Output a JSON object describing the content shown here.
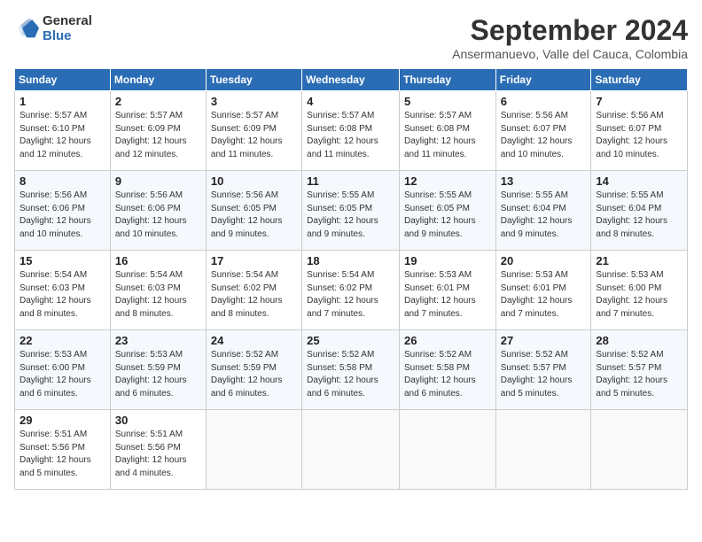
{
  "header": {
    "logo_general": "General",
    "logo_blue": "Blue",
    "month_title": "September 2024",
    "subtitle": "Ansermanuevo, Valle del Cauca, Colombia"
  },
  "days_of_week": [
    "Sunday",
    "Monday",
    "Tuesday",
    "Wednesday",
    "Thursday",
    "Friday",
    "Saturday"
  ],
  "weeks": [
    [
      {
        "day": 1,
        "sunrise": "5:57 AM",
        "sunset": "6:10 PM",
        "daylight": "12 hours and 12 minutes."
      },
      {
        "day": 2,
        "sunrise": "5:57 AM",
        "sunset": "6:09 PM",
        "daylight": "12 hours and 12 minutes."
      },
      {
        "day": 3,
        "sunrise": "5:57 AM",
        "sunset": "6:09 PM",
        "daylight": "12 hours and 11 minutes."
      },
      {
        "day": 4,
        "sunrise": "5:57 AM",
        "sunset": "6:08 PM",
        "daylight": "12 hours and 11 minutes."
      },
      {
        "day": 5,
        "sunrise": "5:57 AM",
        "sunset": "6:08 PM",
        "daylight": "12 hours and 11 minutes."
      },
      {
        "day": 6,
        "sunrise": "5:56 AM",
        "sunset": "6:07 PM",
        "daylight": "12 hours and 10 minutes."
      },
      {
        "day": 7,
        "sunrise": "5:56 AM",
        "sunset": "6:07 PM",
        "daylight": "12 hours and 10 minutes."
      }
    ],
    [
      {
        "day": 8,
        "sunrise": "5:56 AM",
        "sunset": "6:06 PM",
        "daylight": "12 hours and 10 minutes."
      },
      {
        "day": 9,
        "sunrise": "5:56 AM",
        "sunset": "6:06 PM",
        "daylight": "12 hours and 10 minutes."
      },
      {
        "day": 10,
        "sunrise": "5:56 AM",
        "sunset": "6:05 PM",
        "daylight": "12 hours and 9 minutes."
      },
      {
        "day": 11,
        "sunrise": "5:55 AM",
        "sunset": "6:05 PM",
        "daylight": "12 hours and 9 minutes."
      },
      {
        "day": 12,
        "sunrise": "5:55 AM",
        "sunset": "6:05 PM",
        "daylight": "12 hours and 9 minutes."
      },
      {
        "day": 13,
        "sunrise": "5:55 AM",
        "sunset": "6:04 PM",
        "daylight": "12 hours and 9 minutes."
      },
      {
        "day": 14,
        "sunrise": "5:55 AM",
        "sunset": "6:04 PM",
        "daylight": "12 hours and 8 minutes."
      }
    ],
    [
      {
        "day": 15,
        "sunrise": "5:54 AM",
        "sunset": "6:03 PM",
        "daylight": "12 hours and 8 minutes."
      },
      {
        "day": 16,
        "sunrise": "5:54 AM",
        "sunset": "6:03 PM",
        "daylight": "12 hours and 8 minutes."
      },
      {
        "day": 17,
        "sunrise": "5:54 AM",
        "sunset": "6:02 PM",
        "daylight": "12 hours and 8 minutes."
      },
      {
        "day": 18,
        "sunrise": "5:54 AM",
        "sunset": "6:02 PM",
        "daylight": "12 hours and 7 minutes."
      },
      {
        "day": 19,
        "sunrise": "5:53 AM",
        "sunset": "6:01 PM",
        "daylight": "12 hours and 7 minutes."
      },
      {
        "day": 20,
        "sunrise": "5:53 AM",
        "sunset": "6:01 PM",
        "daylight": "12 hours and 7 minutes."
      },
      {
        "day": 21,
        "sunrise": "5:53 AM",
        "sunset": "6:00 PM",
        "daylight": "12 hours and 7 minutes."
      }
    ],
    [
      {
        "day": 22,
        "sunrise": "5:53 AM",
        "sunset": "6:00 PM",
        "daylight": "12 hours and 6 minutes."
      },
      {
        "day": 23,
        "sunrise": "5:53 AM",
        "sunset": "5:59 PM",
        "daylight": "12 hours and 6 minutes."
      },
      {
        "day": 24,
        "sunrise": "5:52 AM",
        "sunset": "5:59 PM",
        "daylight": "12 hours and 6 minutes."
      },
      {
        "day": 25,
        "sunrise": "5:52 AM",
        "sunset": "5:58 PM",
        "daylight": "12 hours and 6 minutes."
      },
      {
        "day": 26,
        "sunrise": "5:52 AM",
        "sunset": "5:58 PM",
        "daylight": "12 hours and 6 minutes."
      },
      {
        "day": 27,
        "sunrise": "5:52 AM",
        "sunset": "5:57 PM",
        "daylight": "12 hours and 5 minutes."
      },
      {
        "day": 28,
        "sunrise": "5:52 AM",
        "sunset": "5:57 PM",
        "daylight": "12 hours and 5 minutes."
      }
    ],
    [
      {
        "day": 29,
        "sunrise": "5:51 AM",
        "sunset": "5:56 PM",
        "daylight": "12 hours and 5 minutes."
      },
      {
        "day": 30,
        "sunrise": "5:51 AM",
        "sunset": "5:56 PM",
        "daylight": "12 hours and 4 minutes."
      },
      null,
      null,
      null,
      null,
      null
    ]
  ]
}
